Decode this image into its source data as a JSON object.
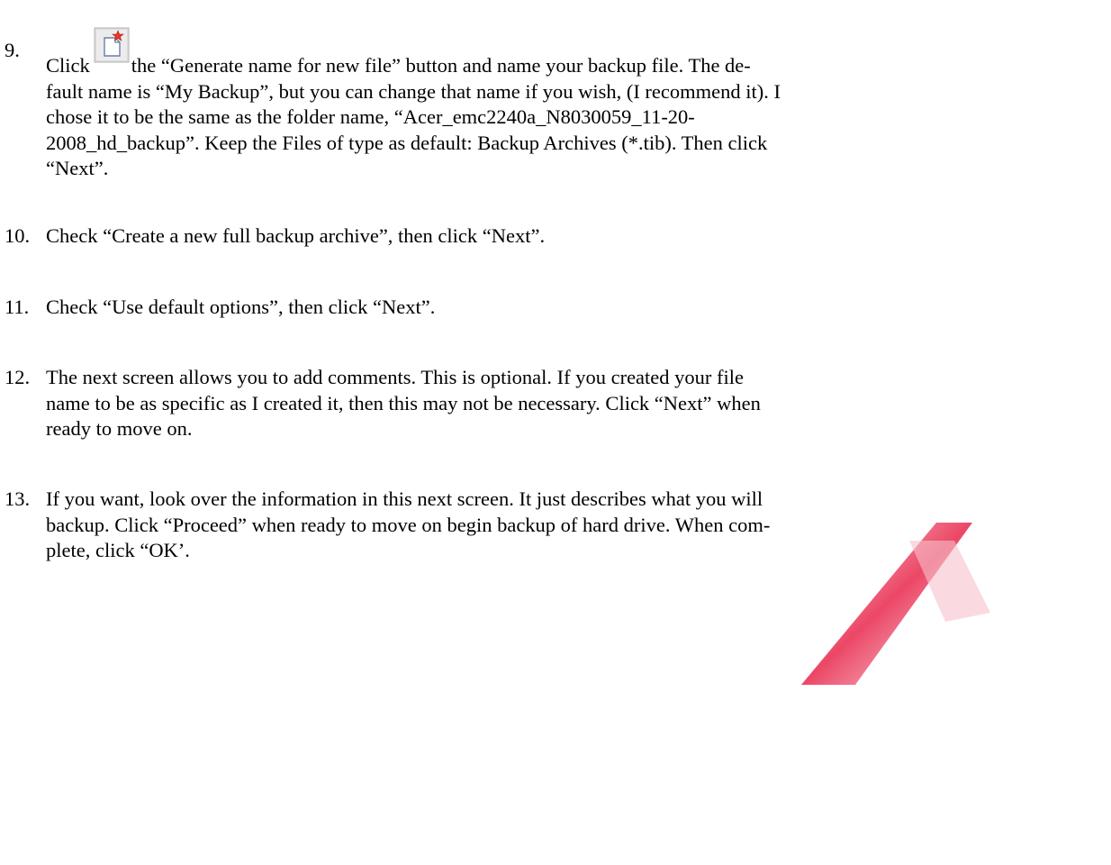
{
  "watermark_color": "#e8264a",
  "steps": [
    {
      "number": "9.",
      "lines": [
        "the “Generate name for new file” button and name your backup file.  The de-",
        "fault name is “My Backup”, but you can change that name if you wish, (I recommend it).  I",
        "chose it to be the same as the folder name, “Acer_emc2240a_N8030059_11-20-",
        "2008_hd_backup”.  Keep the Files of type as default: Backup Archives (*.tib).  Then click",
        "“Next”."
      ],
      "lead": "Click",
      "icon": "new-file-star-icon"
    },
    {
      "number": "10.",
      "lines": [
        "Check “Create a new full backup archive”, then click “Next”."
      ]
    },
    {
      "number": "11.",
      "lines": [
        "Check “Use default options”, then click “Next”."
      ]
    },
    {
      "number": "12.",
      "lines": [
        "The next screen allows you to add comments.  This is optional.  If you created your file",
        "name to be as specific as I created it, then this may not be necessary.  Click “Next” when",
        "ready to move on."
      ]
    },
    {
      "number": "13.",
      "lines": [
        "If you want, look over the information in this next screen.  It just describes what you will",
        "backup.  Click “Proceed” when ready to move on begin backup of hard drive.  When com-",
        "plete, click “OK’."
      ]
    }
  ]
}
